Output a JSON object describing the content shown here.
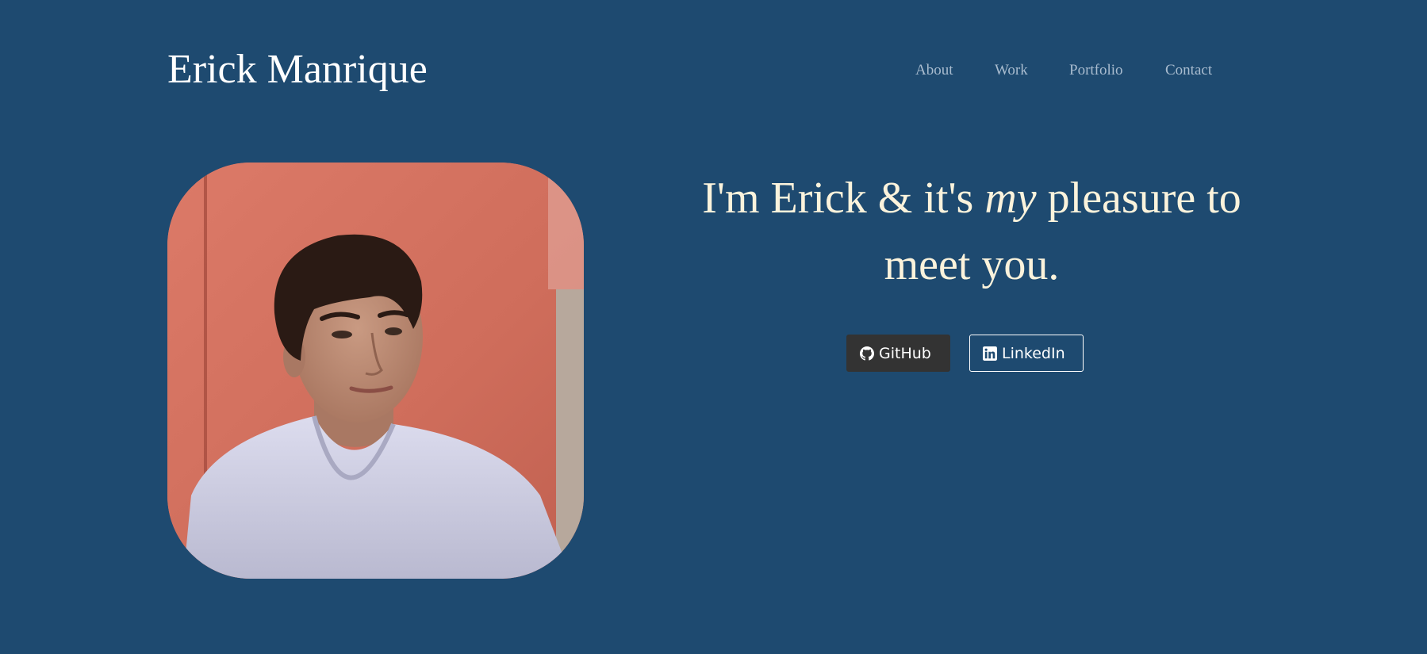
{
  "header": {
    "title": "Erick Manrique",
    "nav": [
      {
        "label": "About"
      },
      {
        "label": "Work"
      },
      {
        "label": "Portfolio"
      },
      {
        "label": "Contact"
      }
    ]
  },
  "hero": {
    "headline_part1": "I'm Erick & it's ",
    "headline_em": "my",
    "headline_part2": " pleasure to meet you.",
    "github_label": "GitHub",
    "linkedin_label": "LinkedIn"
  },
  "icons": {
    "github": "github-icon",
    "linkedin": "linkedin-icon"
  },
  "colors": {
    "background": "#1e4a70",
    "headline": "#fbf3dc",
    "nav": "#a9bccf",
    "github_button": "#333333"
  }
}
